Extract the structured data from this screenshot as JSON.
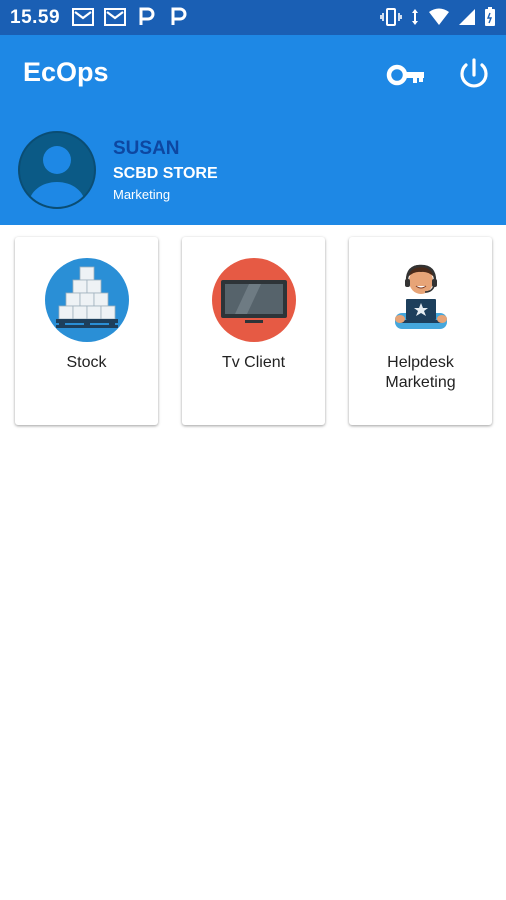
{
  "status_bar": {
    "time": "15.59",
    "left_icons": [
      "gmail-icon",
      "gmail-icon",
      "parking-p-icon",
      "parking-p-icon"
    ],
    "right_icons": [
      "vibrate-icon",
      "data-arrows-icon",
      "wifi-icon",
      "signal-icon",
      "battery-icon"
    ]
  },
  "header": {
    "title": "EcOps",
    "actions": [
      "key-icon",
      "power-icon"
    ],
    "background": "#1e88e5",
    "status_bar_color": "#1a5fb4"
  },
  "profile": {
    "name": "SUSAN",
    "store": "SCBD STORE",
    "department": "Marketing",
    "avatar_color": "#0b5a86",
    "name_color": "#0d47a1"
  },
  "menu": {
    "items": [
      {
        "label_lines": [
          "Stock"
        ],
        "icon": "warehouse-boxes-icon",
        "icon_bg": "#2a8fd6"
      },
      {
        "label_lines": [
          "Tv Client"
        ],
        "icon": "tv-icon",
        "icon_bg": "#e65a44"
      },
      {
        "label_lines": [
          "Helpdesk",
          "Marketing"
        ],
        "icon": "helpdesk-agent-icon",
        "icon_bg": ""
      }
    ]
  }
}
